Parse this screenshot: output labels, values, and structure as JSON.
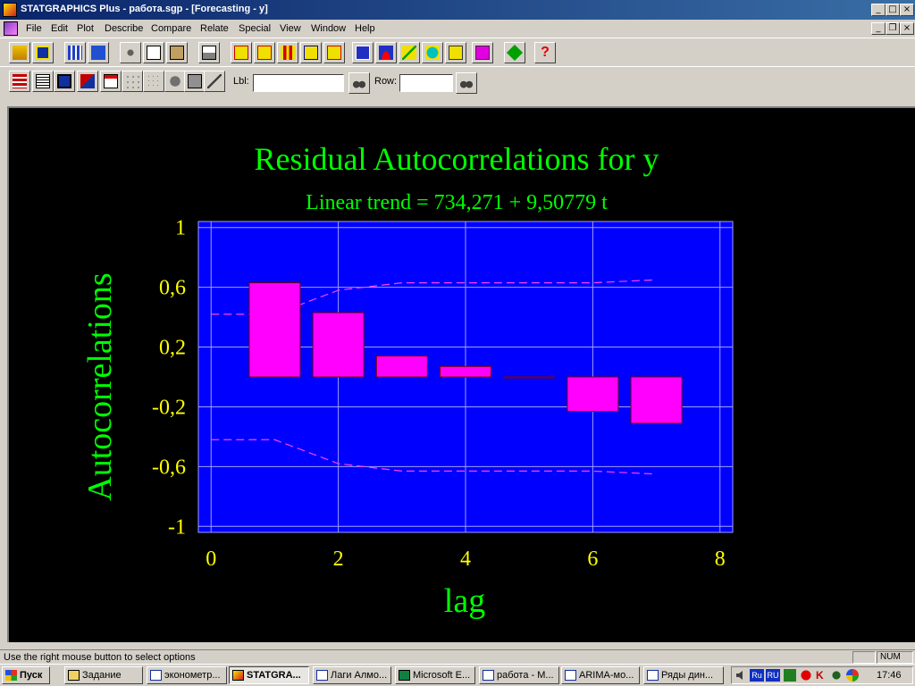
{
  "window": {
    "title": "STATGRAPHICS Plus - работа.sgp - [Forecasting - y]",
    "controls": {
      "minimize": "_",
      "maximize": "□",
      "close": "×",
      "restore": "❐"
    }
  },
  "menu": [
    "File",
    "Edit",
    "Plot",
    "Describe",
    "Compare",
    "Relate",
    "Special",
    "View",
    "Window",
    "Help"
  ],
  "toolbar2": {
    "lbl_label": "Lbl:",
    "lbl_value": "",
    "row_label": "Row:",
    "row_value": ""
  },
  "chart_data": {
    "type": "bar",
    "title": "Residual Autocorrelations for y",
    "subtitle": "Linear trend = 734,271 + 9,50779 t",
    "xlabel": "lag",
    "ylabel": "Autocorrelations",
    "xlim": [
      -0.2,
      8.2
    ],
    "ylim": [
      -1.04,
      1.04
    ],
    "x_ticks": [
      0,
      2,
      4,
      6,
      8
    ],
    "x_tick_labels": [
      "0",
      "2",
      "4",
      "6",
      "8"
    ],
    "y_ticks": [
      1,
      0.6,
      0.2,
      -0.2,
      -0.6,
      -1
    ],
    "y_tick_labels": [
      "1",
      "0,6",
      "0,2",
      "-0,2",
      "-0,6",
      "-1"
    ],
    "grid": true,
    "bar_width": 0.8,
    "lags": [
      1,
      2,
      3,
      4,
      5,
      6,
      7
    ],
    "values": [
      0.63,
      0.43,
      0.14,
      0.07,
      0.0,
      -0.23,
      -0.31
    ],
    "limits": {
      "x": [
        0,
        1,
        2,
        3,
        4,
        5,
        6,
        7
      ],
      "upper": [
        0.42,
        0.42,
        0.58,
        0.63,
        0.63,
        0.63,
        0.63,
        0.65
      ],
      "lower": [
        -0.42,
        -0.42,
        -0.58,
        -0.63,
        -0.63,
        -0.63,
        -0.63,
        -0.65
      ]
    },
    "colors": {
      "plot_bg": "#0000ff",
      "bar_fill": "#ff00ff",
      "bar_edge": "#800000",
      "limit_line": "#ff40ff",
      "title": "#00ff00",
      "tick_labels": "#ffff00",
      "grid": "#a0a0ff"
    }
  },
  "statusbar": {
    "message": "Use the right mouse button to select options",
    "num": "NUM"
  },
  "taskbar": {
    "start_label": "Пуск",
    "tasks": [
      {
        "label": "Задание",
        "active": false
      },
      {
        "label": "эконометр...",
        "active": false
      },
      {
        "label": "STATGRA...",
        "active": true
      },
      {
        "label": "Лаги Алмо...",
        "active": false
      },
      {
        "label": "Microsoft E...",
        "active": false
      },
      {
        "label": "работа - M...",
        "active": false
      },
      {
        "label": "ARIMA-мо...",
        "active": false
      },
      {
        "label": "Ряды дин...",
        "active": false
      }
    ],
    "tray_lang": [
      "Ru",
      "RU"
    ],
    "clock": "17:46"
  }
}
